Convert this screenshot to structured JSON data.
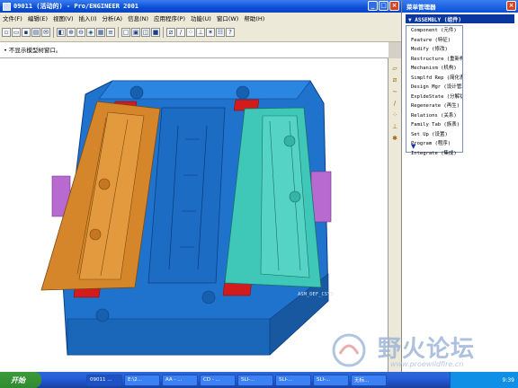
{
  "window": {
    "title": "09011 (活动的) - Pro/ENGINEER 2001",
    "minimize": "_",
    "maximize": "□",
    "close": "×"
  },
  "menus": [
    "文件(F)",
    "编辑(E)",
    "视图(V)",
    "插入(I)",
    "分析(A)",
    "信息(N)",
    "应用程序(P)",
    "功能(U)",
    "窗口(W)",
    "帮助(H)"
  ],
  "toolbar_icons": [
    "new-icon",
    "open-icon",
    "save-icon",
    "print-icon",
    "email-icon",
    "refit-icon",
    "zoom-in-icon",
    "zoom-out-icon",
    "reorient-icon",
    "saved-views-icon",
    "layers-icon",
    "wireframe-icon",
    "hidden-line-icon",
    "no-hidden-icon",
    "shaded-icon",
    "datum-planes-icon",
    "datum-axes-icon",
    "datum-points-icon",
    "coord-sys-icon",
    "spin-center-icon",
    "model-tree-icon",
    "help-icon"
  ],
  "message": "• 不显示模型树窗口。",
  "viewport": {
    "model_label": "ASM_DEF_CSYS"
  },
  "right_toolbar_icons": [
    "sketch-tool-icon",
    "datum-plane-tool-icon",
    "datum-curve-tool-icon",
    "datum-axis-tool-icon",
    "datum-point-tool-icon",
    "csys-tool-icon",
    "analysis-tool-icon"
  ],
  "menu_manager": {
    "title": "菜单管理器",
    "close": "×",
    "header": "▼ ASSEMBLY (组件)",
    "items": [
      "Component (元件)",
      "Feature (特征)",
      "Modify (修改)",
      "Restructure (重新构",
      "Mechanism (机构)",
      "Simplfd Rep (简化表",
      "Design Mgr (设计管理",
      "ExpldeState (分解状",
      "Regenerate (再生)",
      "Relations (关系)",
      "Family Tab (族表)",
      "Set Up (设置)",
      "Program (程序)",
      "Integrate (集成)"
    ],
    "more": "▼"
  },
  "taskbar": {
    "start": "开始",
    "tasks": [
      "09011 ...",
      "E:\\2...",
      "AA - ...",
      "CD - ...",
      "SLI-...",
      "SLI-...",
      "SLI-...",
      "无标..."
    ],
    "tray_time": "9:39"
  },
  "watermark": {
    "text": "野火论坛",
    "url": "www.proewildfire.cn"
  },
  "colors": {
    "base": "#1f73cc",
    "left_slider": "#d5862a",
    "right_slider": "#3fc7b8",
    "lock_red": "#d41b1b",
    "side_block": "#b96ad0",
    "titlebar": "#0a4fd8"
  }
}
